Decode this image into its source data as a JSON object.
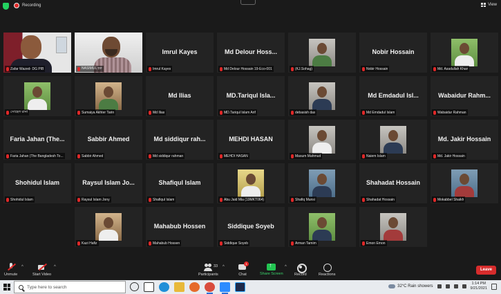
{
  "topbar": {
    "recording_label": "Recording",
    "view_label": "View"
  },
  "tiles": [
    {
      "type": "video1",
      "caption": "Zafar Wazed- DG PIB",
      "speaker": true
    },
    {
      "type": "video2",
      "caption": "NASIMUL হক"
    },
    {
      "type": "name",
      "name": "Imrul Kayes",
      "caption": "Imrul Kayes"
    },
    {
      "type": "name",
      "name": "Md Delour Hoss...",
      "caption": "Md Delour Hossain 19-Eco-001"
    },
    {
      "type": "photo",
      "bg": "ph-bg-gray",
      "body": "green",
      "caption": "(KJ.Sohag)"
    },
    {
      "type": "name",
      "name": "Nobir Hossain",
      "caption": "Nobir Hossain"
    },
    {
      "type": "photo",
      "bg": "ph-bg-green",
      "body": "light",
      "caption": "Md. Asadullah Khan"
    },
    {
      "type": "photo",
      "bg": "ph-bg-green",
      "body": "light",
      "caption": "সোহেল রানা"
    },
    {
      "type": "photo",
      "bg": "ph-bg-warm",
      "body": "green",
      "caption": "Sumaiya Akhter Tarin"
    },
    {
      "type": "name",
      "name": "Md Ilias",
      "caption": "Md Ilias"
    },
    {
      "type": "name",
      "name": "MD.Tariqul Isla...",
      "caption": "MD.Tariqul Islam Arif"
    },
    {
      "type": "photo",
      "bg": "ph-bg-gray",
      "body": "dark",
      "caption": "debasish das"
    },
    {
      "type": "name",
      "name": "Md  Emdadul Isl...",
      "caption": "Md Emdadul Islam"
    },
    {
      "type": "name",
      "name": "Wabaidur  Rahm...",
      "caption": "Wabaidur Rahman"
    },
    {
      "type": "name",
      "name": "Faria  Jahan  (The...",
      "caption": "Faria Jahan (The Bangladesh To..."
    },
    {
      "type": "name",
      "name": "Sabbir Ahmed",
      "caption": "Sabbir Ahmed"
    },
    {
      "type": "name",
      "name": "Md siddiqur  rah...",
      "caption": "Md siddiqur rahman"
    },
    {
      "type": "name",
      "name": "MEHDI HASAN",
      "caption": "MEHDI HASAN"
    },
    {
      "type": "photo",
      "bg": "ph-bg-gray",
      "body": "light",
      "caption": "Masum Mahmud"
    },
    {
      "type": "photo",
      "bg": "ph-bg-gray",
      "body": "dark",
      "caption": "Naiem Islam"
    },
    {
      "type": "name",
      "name": "Md. Jakir Hossain",
      "caption": "Md. Jakir Hossain"
    },
    {
      "type": "name",
      "name": "Shohidul Islam",
      "caption": "Shohidul Islam"
    },
    {
      "type": "name",
      "name": "Raysul  Islam  Jo...",
      "caption": "Raysul  Islam Jony"
    },
    {
      "type": "name",
      "name": "Shafiqul Islam",
      "caption": "Shafiqul Islam"
    },
    {
      "type": "photo",
      "bg": "ph-bg-yellow",
      "body": "light",
      "caption": "Abu Jaid Mia (19MKT064)"
    },
    {
      "type": "photo",
      "bg": "ph-bg-blue",
      "body": "dark",
      "caption": "Shafiq Munsi"
    },
    {
      "type": "name",
      "name": "Shahadat Hossain",
      "caption": "Shahadat Hossain"
    },
    {
      "type": "photo",
      "bg": "ph-bg-blue",
      "body": "red",
      "caption": "Mokabbel Shaikh"
    },
    {
      "type": "empty"
    },
    {
      "type": "photo",
      "bg": "ph-bg-warm",
      "body": "light",
      "caption": "Kazi Hafiz"
    },
    {
      "type": "name",
      "name": "Mahabub Hossen",
      "caption": "Mahabub Hossen"
    },
    {
      "type": "name",
      "name": "Siddique Soyeb",
      "caption": "Siddique Soyeb"
    },
    {
      "type": "photo",
      "bg": "ph-bg-green",
      "body": "dark",
      "caption": "Arman Tamim"
    },
    {
      "type": "photo",
      "bg": "ph-bg-gray",
      "body": "red",
      "caption": "Emon Emon"
    },
    {
      "type": "empty"
    }
  ],
  "toolbar": {
    "unmute": "Unmute",
    "start_video": "Start Video",
    "participants": "Participants",
    "participants_count": "33",
    "chat": "Chat",
    "chat_badge": "1",
    "share_screen": "Share Screen",
    "record": "Record",
    "reactions": "Reactions",
    "leave": "Leave"
  },
  "taskbar": {
    "search_placeholder": "Type here to search",
    "weather": "32°C  Rain showers",
    "time": "1:14 PM",
    "date": "9/21/2021"
  }
}
